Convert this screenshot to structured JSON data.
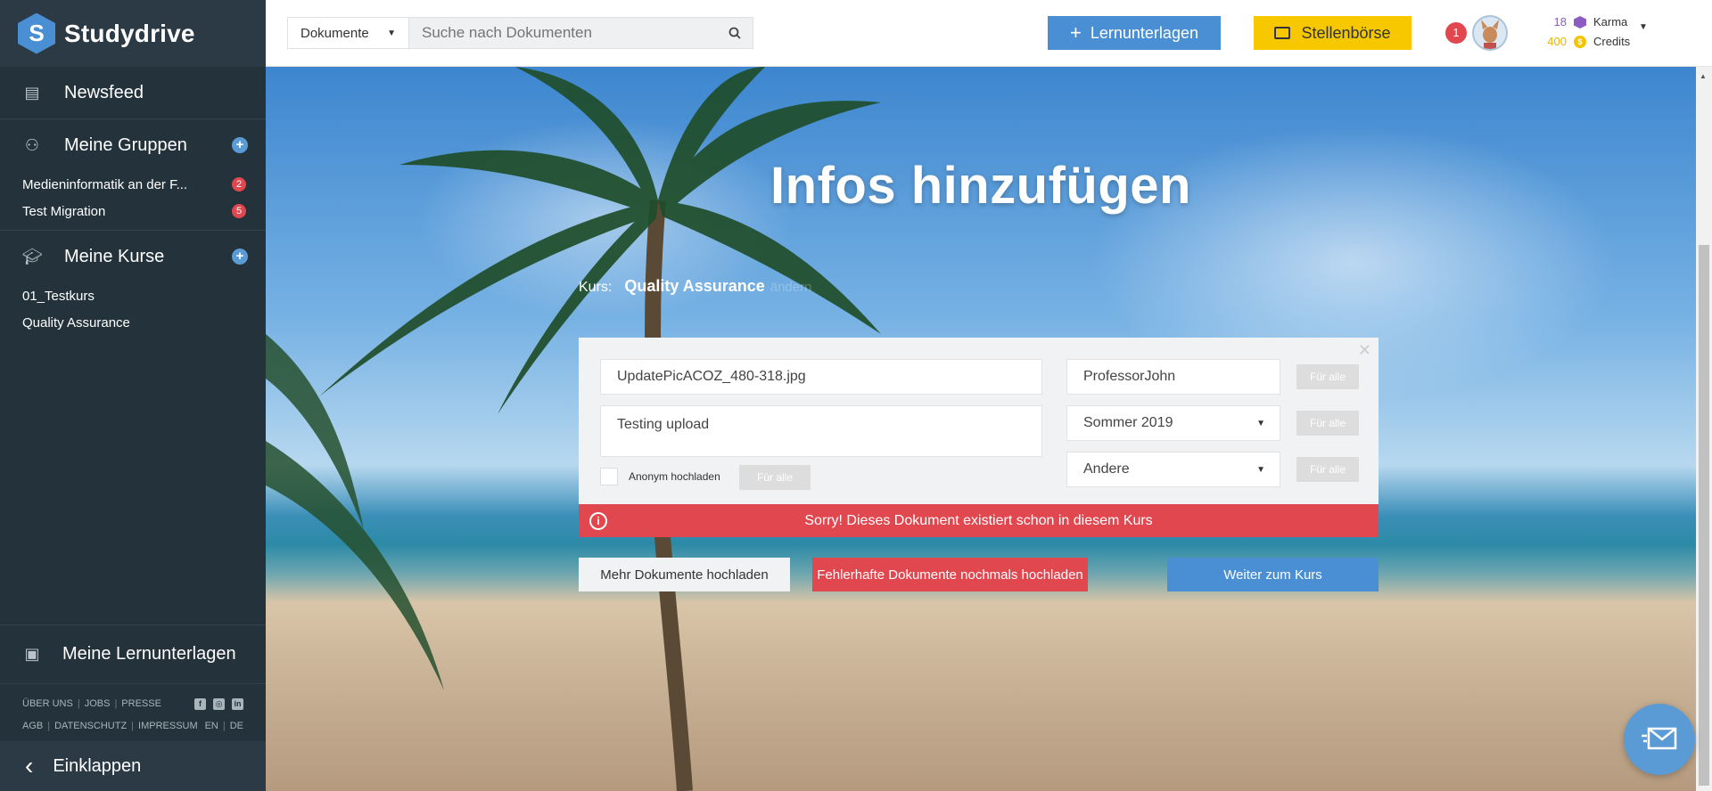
{
  "brand": {
    "logo_letter": "S",
    "name": "Studydrive"
  },
  "sidebar": {
    "newsfeed": "Newsfeed",
    "groups": {
      "title": "Meine Gruppen",
      "items": [
        {
          "label": "Medieninformatik an der F...",
          "count": "2"
        },
        {
          "label": "Test Migration",
          "count": "5"
        }
      ]
    },
    "courses": {
      "title": "Meine Kurse",
      "items": [
        {
          "label": "01_Testkurs"
        },
        {
          "label": "Quality Assurance"
        }
      ]
    },
    "lernunterlagen": "Meine Lernunterlagen",
    "footer": {
      "row1": [
        "ÜBER UNS",
        "JOBS",
        "PRESSE"
      ],
      "row2": [
        "AGB",
        "DATENSCHUTZ",
        "IMPRESSUM"
      ],
      "lang": [
        "EN",
        "DE"
      ]
    },
    "collapse": "Einklappen"
  },
  "topbar": {
    "search_scope": "Dokumente",
    "search_placeholder": "Suche nach Dokumenten",
    "btn_lern": "Lernunterlagen",
    "btn_stellen": "Stellenbörse",
    "notifications": "1",
    "karma_value": "18",
    "karma_label": "Karma",
    "credits_value": "400",
    "credits_label": "Credits"
  },
  "main": {
    "title": "Infos hinzufügen",
    "kurs_label": "Kurs:",
    "kurs_name": "Quality Assurance",
    "kurs_change": "ändern",
    "form": {
      "filename": "UpdatePicACOZ_480-318.jpg",
      "description": "Testing upload",
      "professor": "ProfessorJohn",
      "semester": "Sommer 2019",
      "type": "Andere",
      "fuer_alle": "Für alle",
      "anon_label": "Anonym hochladen"
    },
    "error": "Sorry! Dieses Dokument existiert schon in diesem Kurs",
    "btn_more": "Mehr Dokumente hochladen",
    "btn_retry": "Fehlerhafte Dokumente nochmals hochladen",
    "btn_next": "Weiter zum Kurs"
  },
  "colors": {
    "sidebar_bg": "#24323b",
    "primary_blue": "#4a8fd4",
    "accent_yellow": "#f7c800",
    "error_red": "#e0474f",
    "karma_purple": "#8b5cc4"
  }
}
